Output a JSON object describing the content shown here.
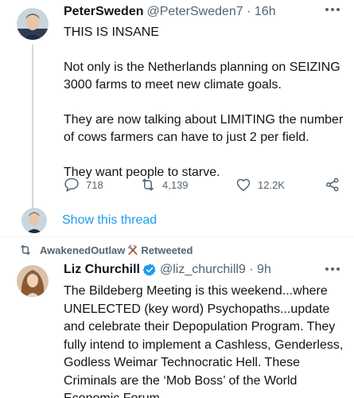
{
  "tweet1": {
    "display_name": "PeterSweden",
    "handle_time": "@PeterSweden7 · 16h",
    "paragraphs": [
      "THIS IS INSANE",
      "Not only is the Netherlands planning on SEIZING 3000 farms to meet new climate goals.",
      "They are now talking about LIMITING the number of cows farmers can have to just 2 per field.",
      "They want people to starve."
    ],
    "replies": "718",
    "retweets": "4,139",
    "likes": "12.2K"
  },
  "thread": {
    "show_label": "Show this thread"
  },
  "retweet_banner": {
    "text_before": "AwakenedOutlaw",
    "emoji": "hammer-and-pick",
    "text_after": "Retweeted"
  },
  "tweet2": {
    "display_name": "Liz Churchill",
    "handle_time": "@liz_churchill9 · 9h",
    "text": "The Bildeberg Meeting is this weekend...where UNELECTED (key word) Psychopaths...update and celebrate their Depopulation Program. They fully intend to implement a Cashless, Genderless, Godless Weimar Technocratic Hell. These Criminals are the ‘Mob Boss’ of the World Economic Forum."
  },
  "colors": {
    "text": "#0f1419",
    "secondary": "#536471",
    "link": "#1d9bf0",
    "verified": "#1d9bf0",
    "border": "#eff3f4"
  },
  "icons": [
    "more-icon",
    "reply-icon",
    "retweet-icon",
    "like-icon",
    "share-icon",
    "verified-icon"
  ]
}
